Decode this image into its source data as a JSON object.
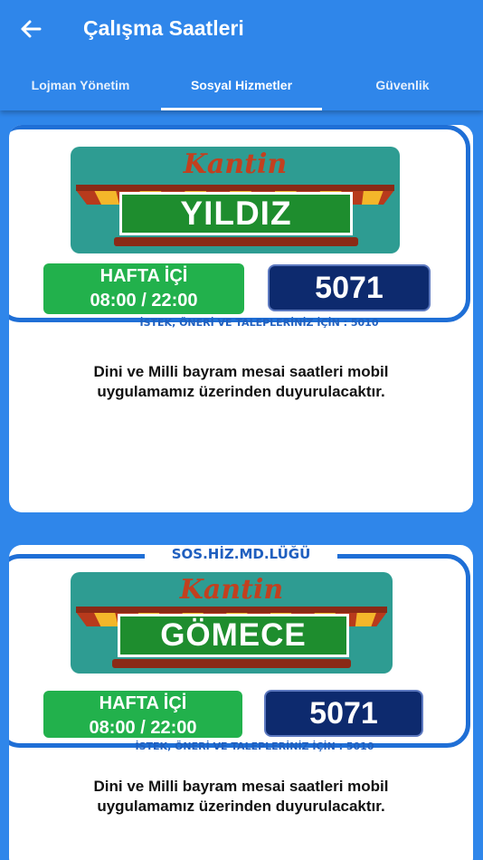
{
  "header": {
    "title": "Çalışma Saatleri"
  },
  "tabs": [
    {
      "label": "Lojman Yönetim"
    },
    {
      "label": "Sosyal Hizmetler",
      "active": true
    },
    {
      "label": "Güvenlik"
    }
  ],
  "cards": [
    {
      "kantin_text": "Kantin",
      "sign": "YILDIZ",
      "hafta_line1": "HAFTA İÇİ",
      "hafta_line2": "08:00 / 22:00",
      "phone": "5071",
      "istek": "İSTEK, ÖNERİ VE TALEPLERİNİZ İÇİN : 5010",
      "notice_line1": "Dini ve Milli bayram mesai saatleri mobil",
      "notice_line2": "uygulamamız üzerinden duyurulacaktır."
    },
    {
      "header_label": "SOS.HİZ.MD.LÜĞÜ",
      "kantin_text": "Kantin",
      "sign": "GÖMECE",
      "hafta_line1": "HAFTA İÇİ",
      "hafta_line2": "08:00 / 22:00",
      "phone": "5071",
      "istek": "İSTEK, ÖNERİ VE TALEPLERİNİZ İÇİN : 5010",
      "notice_line1": "Dini ve Milli bayram mesai saatleri mobil",
      "notice_line2": "uygulamamız  üzerinden duyurulacaktır."
    }
  ],
  "colors": {
    "primary": "#2f86ea",
    "frame": "#1f6fd6",
    "hafta_bg": "#22b14c",
    "number_bg": "#0d2a6e",
    "board": "#2e9c92",
    "sign_bg": "#1e8d2e"
  },
  "icons": {
    "back": "arrow-left-icon"
  }
}
